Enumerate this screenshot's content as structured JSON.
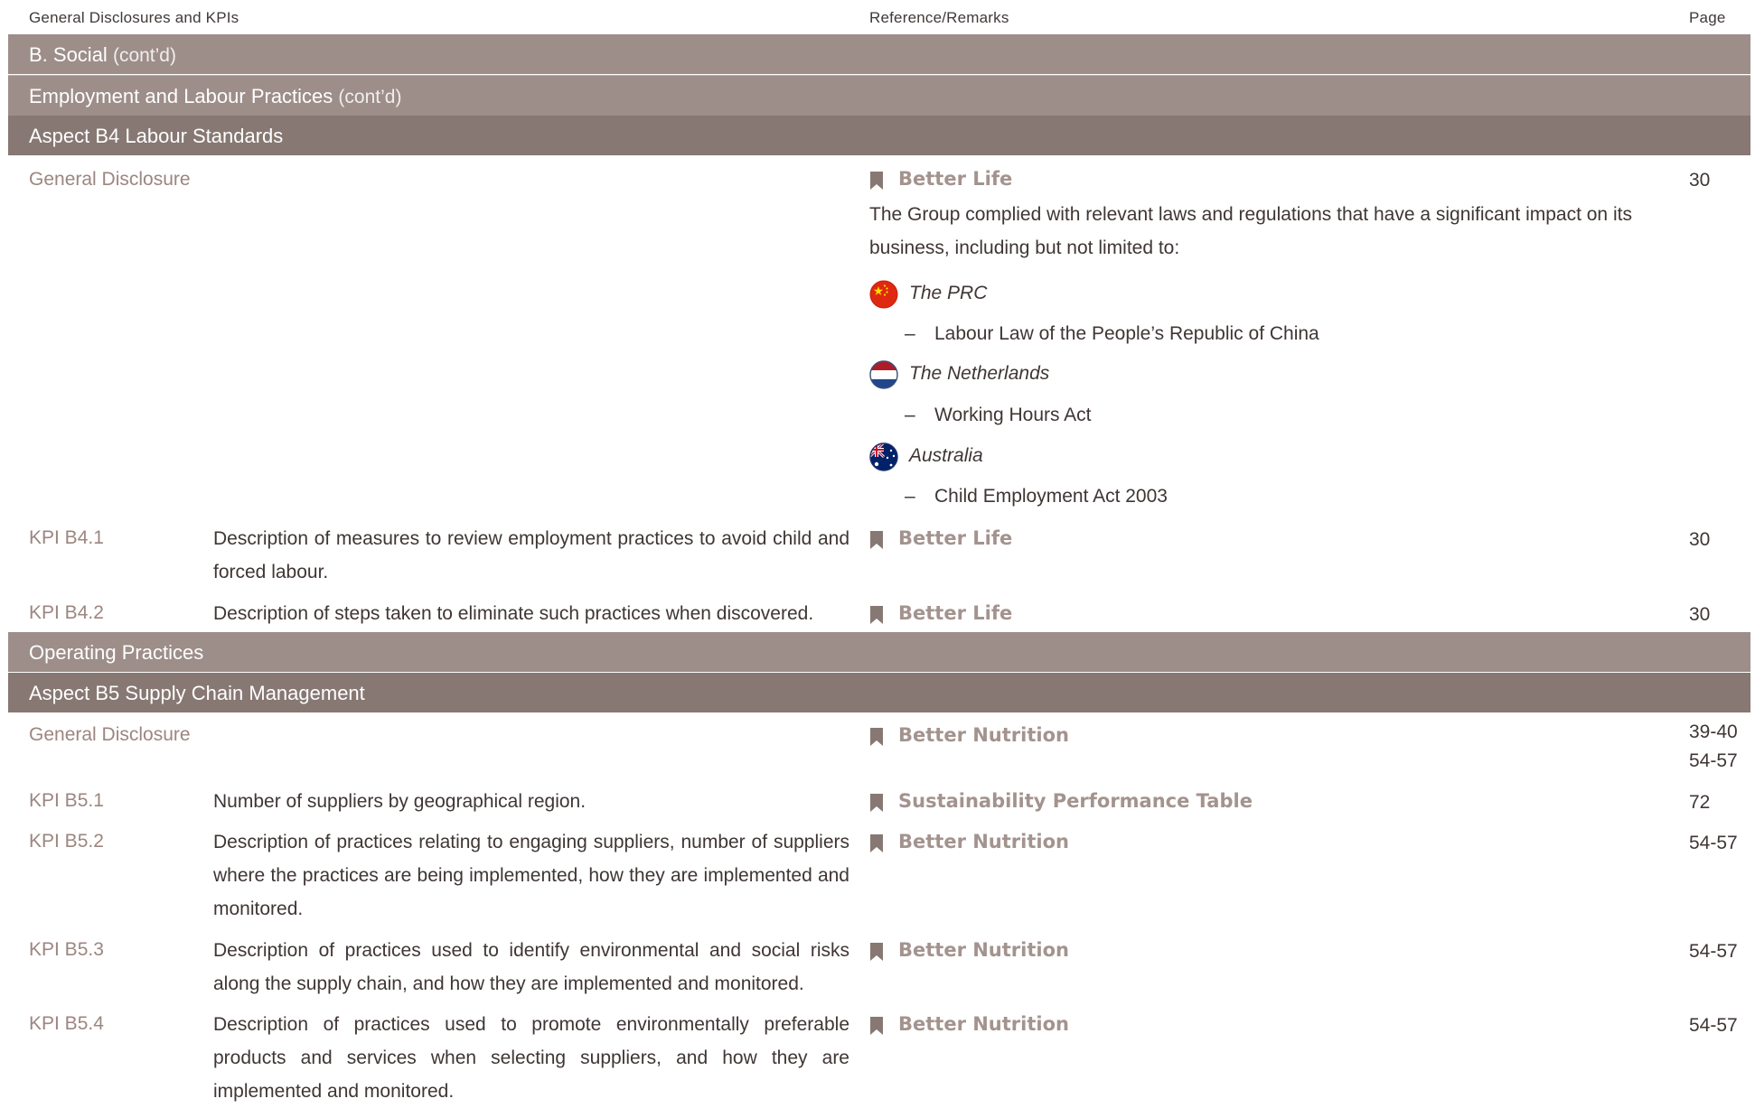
{
  "header": {
    "col1": "General Disclosures and KPIs",
    "col2": "Reference/Remarks",
    "col3": "Page"
  },
  "section_b": {
    "title": "B. Social",
    "cont": "(cont’d)"
  },
  "employment": {
    "title": "Employment and Labour Practices",
    "cont": "(cont’d)"
  },
  "aspect_b4": {
    "title": "Aspect B4 Labour Standards",
    "general": {
      "label": "General Disclosure",
      "ref": "Better Life",
      "page": "30",
      "paragraph": "The Group complied with relevant laws and regulations that have a significant impact on its business, including but not limited to:",
      "dash": "–",
      "countries": [
        {
          "name": "The PRC",
          "flag": "china-flag-icon",
          "law": "Labour Law of the People’s Republic of China"
        },
        {
          "name": "The Netherlands",
          "flag": "netherlands-flag-icon",
          "law": "Working Hours Act"
        },
        {
          "name": "Australia",
          "flag": "australia-flag-icon",
          "law": "Child Employment Act 2003"
        }
      ]
    },
    "kpis": [
      {
        "label": "KPI B4.1",
        "desc": "Description of measures to review employment practices to avoid child and forced labour.",
        "ref": "Better Life",
        "page": "30"
      },
      {
        "label": "KPI B4.2",
        "desc": "Description of steps taken to eliminate such practices when discovered.",
        "ref": "Better Life",
        "page": "30"
      }
    ]
  },
  "operating": {
    "title": "Operating Practices"
  },
  "aspect_b5": {
    "title": "Aspect B5 Supply Chain Management",
    "general": {
      "label": "General Disclosure",
      "ref": "Better Nutrition",
      "pages": [
        "39-40",
        "54-57"
      ]
    },
    "kpis": [
      {
        "label": "KPI B5.1",
        "desc": "Number of suppliers by geographical region.",
        "ref": "Sustainability Performance Table",
        "page": "72"
      },
      {
        "label": "KPI B5.2",
        "desc": "Description of practices relating to engaging suppliers, number of suppliers where the practices are being implemented, how they are implemented and monitored.",
        "ref": "Better Nutrition",
        "page": "54-57"
      },
      {
        "label": "KPI B5.3",
        "desc": "Description of practices used to identify environmental and social risks along the supply chain, and how they are implemented and monitored.",
        "ref": "Better Nutrition",
        "page": "54-57"
      },
      {
        "label": "KPI B5.4",
        "desc": "Description of practices used to promote environmentally preferable products and services when selecting suppliers, and how they are implemented and monitored.",
        "ref": "Better Nutrition",
        "page": "54-57"
      }
    ]
  },
  "colors": {
    "band_light": "#9d8e89",
    "band_dark": "#877873",
    "label_text": "#9c8680",
    "reference_text": "#a3938e",
    "bookmark_icon": "#877873"
  }
}
